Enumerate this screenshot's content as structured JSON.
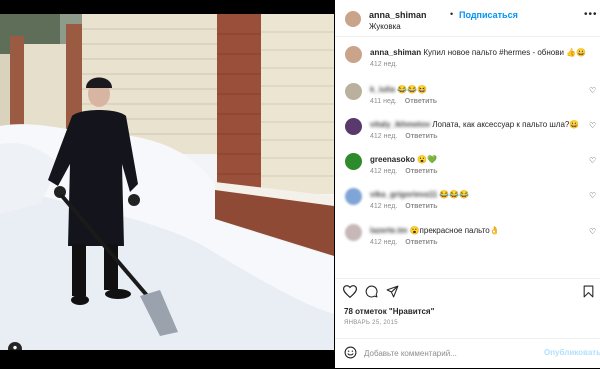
{
  "header": {
    "username": "anna_shiman",
    "separator": "•",
    "follow_label": "Подписаться",
    "location": "Жуковка",
    "more": "•••"
  },
  "caption": {
    "username": "anna_shiman",
    "text_before": "Купил новое пальто ",
    "hashtag": "#hermes",
    "text_after": " - обнови 👍😀",
    "time": "412 нед."
  },
  "comments": [
    {
      "username": "k_iulia",
      "text": "😂😂😆",
      "time": "411 нед.",
      "reply": "Ответить",
      "avatar_color": "#b9b19d"
    },
    {
      "username": "vitaly_ikhmetov",
      "text": "Лопата, как аксессуар к пальто шла?😀",
      "time": "412 нед.",
      "reply": "Ответить",
      "avatar_color": "#5a3a6e"
    },
    {
      "username": "greenasoko",
      "text": "😮💚",
      "time": "412 нед.",
      "reply": "Ответить",
      "avatar_color": "#2d8a2d"
    },
    {
      "username": "vika_grigorieva11",
      "text": "😂😂😂",
      "time": "412 нед.",
      "reply": "Ответить",
      "avatar_color": "#7fa4d6"
    },
    {
      "username": "lazerte.tm",
      "text": "😮прекрасное пальто👌",
      "time": "412 нед.",
      "reply": "Ответить",
      "avatar_color": "#c7b8b8"
    }
  ],
  "likes_text": "78 отметок \"Нравится\"",
  "date_text": "ЯНВАРЬ 25, 2015",
  "comment_input": {
    "placeholder": "Добавьте комментарий..."
  },
  "publish_label": "Опубликовать",
  "colors": {
    "link_blue": "#0095f6",
    "publish_disabled": "#b2dffc",
    "secondary": "#8e8e8e"
  }
}
